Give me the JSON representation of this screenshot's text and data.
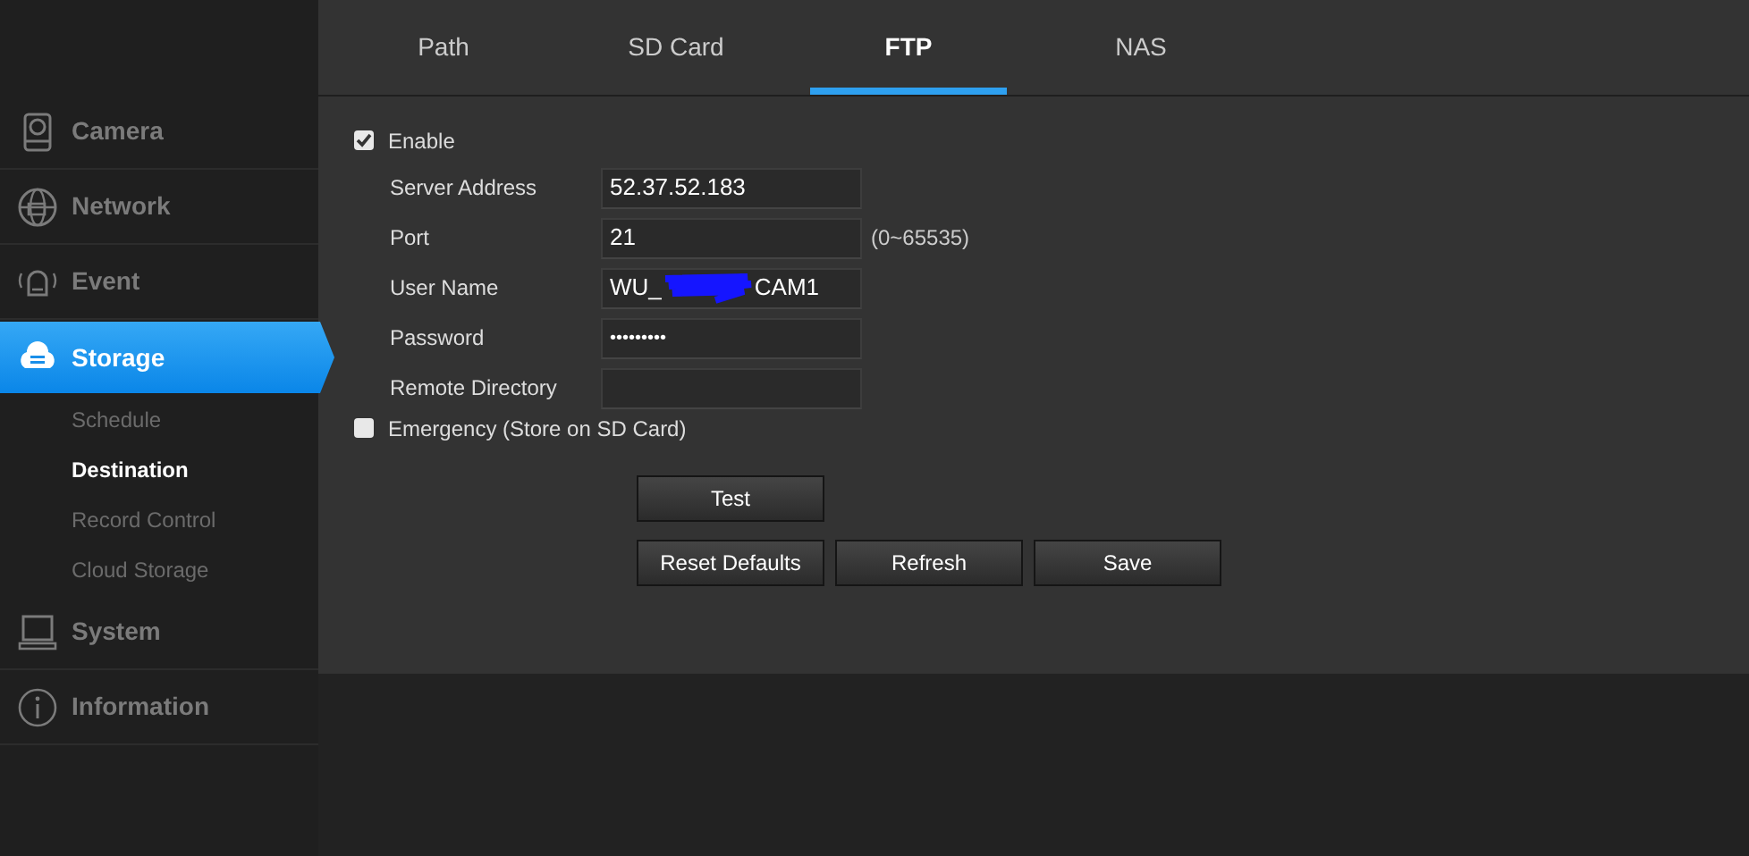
{
  "sidebar": {
    "items": [
      {
        "label": "Camera",
        "selected": false
      },
      {
        "label": "Network",
        "selected": false
      },
      {
        "label": "Event",
        "selected": false
      },
      {
        "label": "Storage",
        "selected": true,
        "children": [
          {
            "label": "Schedule",
            "selected": false
          },
          {
            "label": "Destination",
            "selected": true
          },
          {
            "label": "Record Control",
            "selected": false
          },
          {
            "label": "Cloud Storage",
            "selected": false
          }
        ]
      },
      {
        "label": "System",
        "selected": false
      },
      {
        "label": "Information",
        "selected": false
      }
    ]
  },
  "tabs": [
    {
      "label": "Path",
      "selected": false
    },
    {
      "label": "SD Card",
      "selected": false
    },
    {
      "label": "FTP",
      "selected": true
    },
    {
      "label": "NAS",
      "selected": false
    }
  ],
  "form": {
    "enable": {
      "label": "Enable",
      "checked": true
    },
    "fields": [
      {
        "label": "Server Address",
        "kind": "text",
        "value": "52.37.52.183"
      },
      {
        "label": "Port",
        "kind": "text",
        "value": "21",
        "hint": "(0~65535)"
      },
      {
        "label": "User Name",
        "kind": "redacted",
        "value_parts": [
          "WU_",
          "CAM1"
        ]
      },
      {
        "label": "Password",
        "kind": "password",
        "value": "•••••••••"
      },
      {
        "label": "Remote Directory",
        "kind": "text"
      }
    ],
    "emergency": {
      "label": "Emergency (Store on SD Card)",
      "checked": false
    }
  },
  "buttons": [
    [
      "Test"
    ],
    [
      "Reset Defaults",
      "Refresh",
      "Save"
    ]
  ]
}
